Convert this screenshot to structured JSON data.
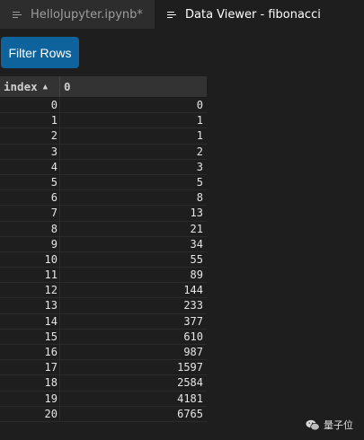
{
  "tabs": [
    {
      "label": "HelloJupyter.ipynb*",
      "active": false
    },
    {
      "label": "Data Viewer - fibonacci",
      "active": true
    }
  ],
  "toolbar": {
    "filter_label": "Filter Rows"
  },
  "table": {
    "columns": [
      "index",
      "0"
    ],
    "sort_indicator": "▲",
    "rows": [
      [
        "0",
        "0"
      ],
      [
        "1",
        "1"
      ],
      [
        "2",
        "1"
      ],
      [
        "3",
        "2"
      ],
      [
        "4",
        "3"
      ],
      [
        "5",
        "5"
      ],
      [
        "6",
        "8"
      ],
      [
        "7",
        "13"
      ],
      [
        "8",
        "21"
      ],
      [
        "9",
        "34"
      ],
      [
        "10",
        "55"
      ],
      [
        "11",
        "89"
      ],
      [
        "12",
        "144"
      ],
      [
        "13",
        "233"
      ],
      [
        "14",
        "377"
      ],
      [
        "15",
        "610"
      ],
      [
        "16",
        "987"
      ],
      [
        "17",
        "1597"
      ],
      [
        "18",
        "2584"
      ],
      [
        "19",
        "4181"
      ],
      [
        "20",
        "6765"
      ]
    ]
  },
  "watermark": {
    "text": "量子位"
  },
  "colors": {
    "accent": "#0e639c",
    "background": "#1e1e1e",
    "tab_bar": "#252526"
  }
}
